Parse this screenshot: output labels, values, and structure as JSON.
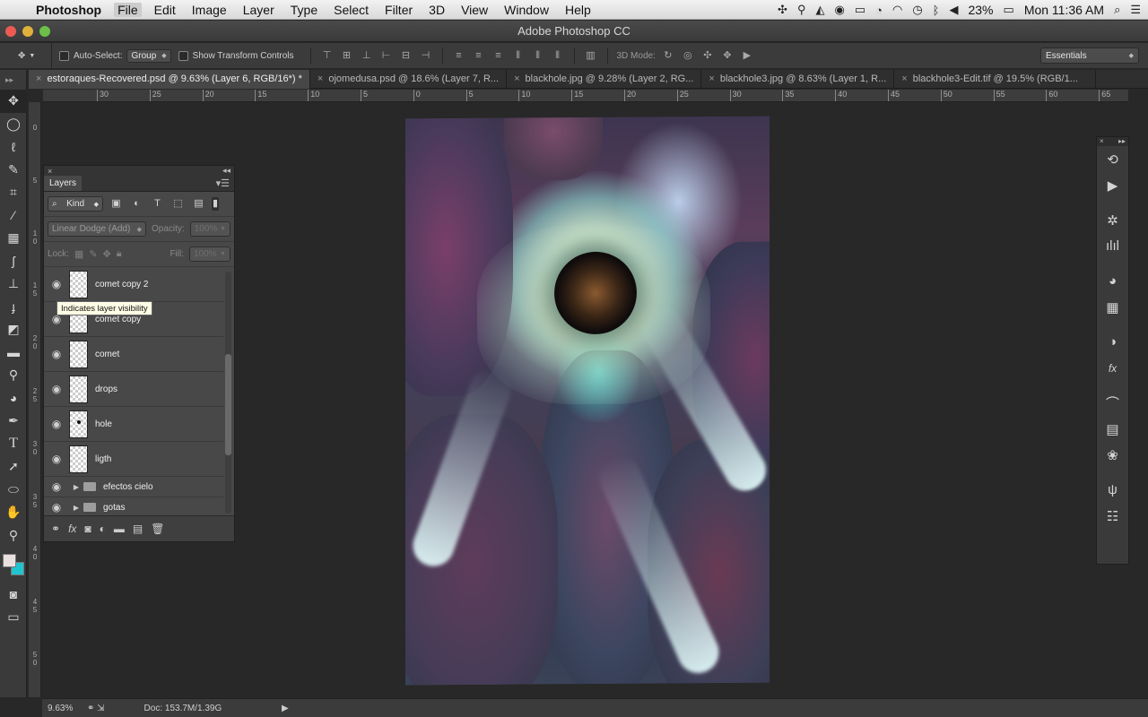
{
  "menubar": {
    "app": "Photoshop",
    "items": [
      "File",
      "Edit",
      "Image",
      "Layer",
      "Type",
      "Select",
      "Filter",
      "3D",
      "View",
      "Window",
      "Help"
    ],
    "battery": "23%",
    "clock": "Mon 11:36 AM"
  },
  "window": {
    "title": "Adobe Photoshop CC"
  },
  "options": {
    "auto_select_label": "Auto-Select:",
    "auto_select_value": "Group",
    "transform_label": "Show Transform Controls",
    "mode_3d_label": "3D Mode:",
    "workspace": "Essentials"
  },
  "tabs": [
    {
      "label": "estoraques-Recovered.psd @ 9.63% (Layer 6, RGB/16*) *",
      "active": true
    },
    {
      "label": "ojomedusa.psd @ 18.6% (Layer 7, R...",
      "active": false
    },
    {
      "label": "blackhole.jpg @ 9.28% (Layer 2, RG...",
      "active": false
    },
    {
      "label": "blackhole3.jpg @ 8.63% (Layer 1, R...",
      "active": false
    },
    {
      "label": "blackhole3-Edit.tif @ 19.5% (RGB/1...",
      "active": false
    }
  ],
  "ruler_top": [
    "30",
    "25",
    "20",
    "15",
    "10",
    "5",
    "0",
    "5",
    "10",
    "15",
    "20",
    "25",
    "30",
    "35",
    "40",
    "45",
    "50",
    "55",
    "60",
    "65"
  ],
  "ruler_left": [
    "0",
    "5",
    "1 0",
    "1 5",
    "2 0",
    "2 5",
    "3 0",
    "3 5",
    "4 0",
    "4 5",
    "5 0",
    "5"
  ],
  "layers_panel": {
    "title": "Layers",
    "filter_kind": "Kind",
    "blend_mode": "Linear Dodge (Add)",
    "opacity_label": "Opacity:",
    "opacity_value": "100%",
    "lock_label": "Lock:",
    "fill_label": "Fill:",
    "fill_value": "100%",
    "layers": [
      "comet copy 2",
      "comet copy",
      "comet",
      "drops",
      "hole",
      "ligth"
    ],
    "groups": [
      "efectos cielo",
      "gotas"
    ],
    "tooltip": "Indicates layer visibility"
  },
  "status": {
    "zoom": "9.63%",
    "doc": "Doc: 153.7M/1.39G"
  },
  "colors": {
    "foreground": "#e9e0e0",
    "background": "#1fc4ce"
  },
  "icons": {
    "tools": [
      "move-icon",
      "ellipse-marquee-icon",
      "lasso-icon",
      "quick-select-icon",
      "crop-icon",
      "eyedropper-icon",
      "spot-heal-icon",
      "brush-icon",
      "clone-stamp-icon",
      "history-brush-icon",
      "eraser-icon",
      "gradient-icon",
      "blur-icon",
      "dodge-icon",
      "pen-icon",
      "type-icon",
      "path-select-icon",
      "ellipse-shape-icon",
      "hand-icon",
      "zoom-icon"
    ]
  }
}
